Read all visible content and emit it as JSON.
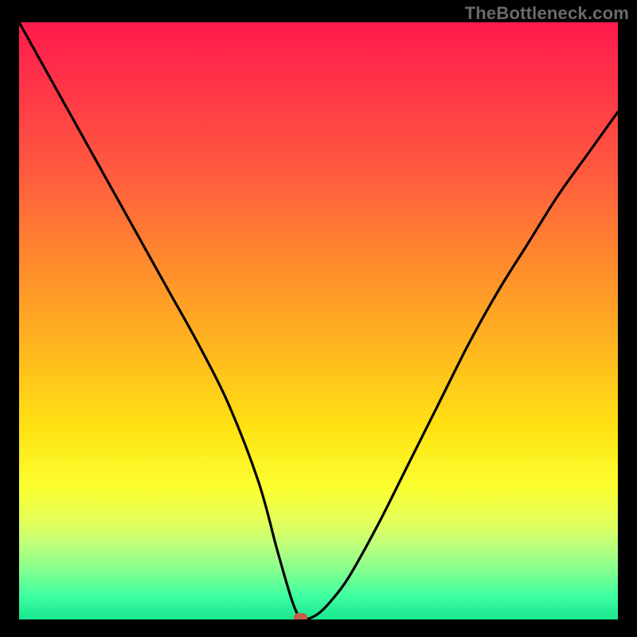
{
  "watermark": "TheBottleneck.com",
  "chart_data": {
    "type": "line",
    "title": "",
    "xlabel": "",
    "ylabel": "",
    "xlim": [
      0,
      100
    ],
    "ylim": [
      0,
      100
    ],
    "background_gradient": {
      "top_color": "#ff1a4d",
      "bottom_color": "#18e690",
      "direction": "vertical"
    },
    "series": [
      {
        "name": "bottleneck-curve",
        "x": [
          0,
          5,
          10,
          15,
          20,
          25,
          30,
          35,
          40,
          43,
          45,
          46,
          47,
          48,
          50,
          52,
          55,
          60,
          65,
          70,
          75,
          80,
          85,
          90,
          95,
          100
        ],
        "y": [
          100,
          91,
          82,
          73,
          64,
          55,
          46,
          36,
          23,
          12,
          5,
          2,
          0,
          0,
          1,
          3,
          7,
          16,
          26,
          36,
          46,
          55,
          63,
          71,
          78,
          85
        ]
      }
    ],
    "marker": {
      "x": 47,
      "y": 0,
      "shape": "rounded-rect",
      "color": "#c85a4a"
    }
  }
}
